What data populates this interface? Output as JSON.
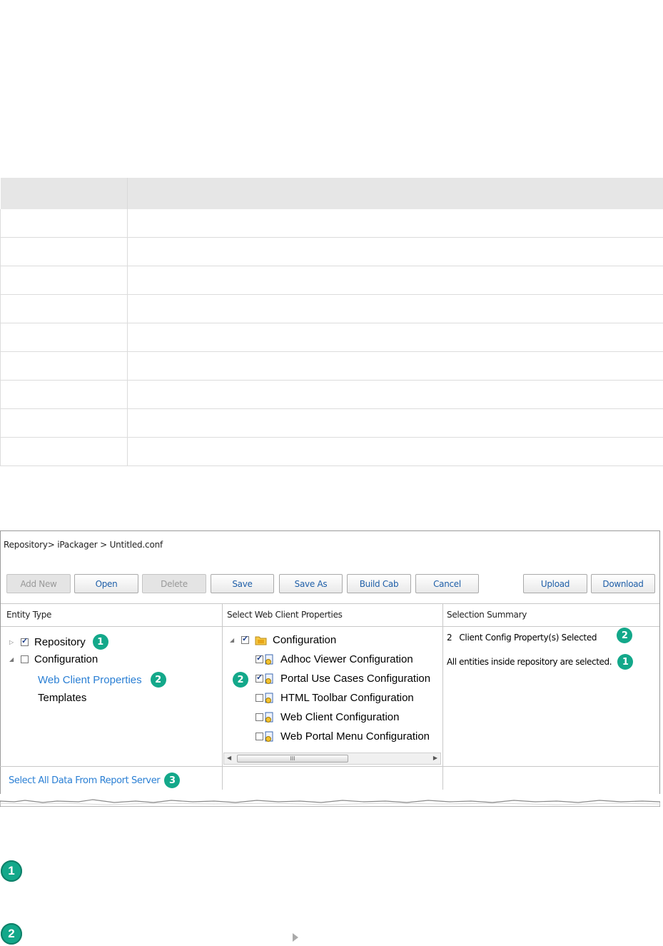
{
  "table": {
    "rows": 9
  },
  "screenshot": {
    "breadcrumb": "Repository> iPackager > Untitled.conf",
    "buttons": [
      {
        "label": "Add New",
        "disabled": true
      },
      {
        "label": "Open",
        "disabled": false
      },
      {
        "label": "Delete",
        "disabled": true
      },
      {
        "label": "Save",
        "disabled": false
      },
      {
        "label": "Save As",
        "disabled": false
      },
      {
        "label": "Build Cab",
        "disabled": false
      },
      {
        "label": "Cancel",
        "disabled": false
      },
      {
        "label": "Upload",
        "disabled": false
      },
      {
        "label": "Download",
        "disabled": false
      }
    ],
    "headers": {
      "entity_type": "Entity Type",
      "select_properties": "Select Web Client Properties",
      "selection_summary": "Selection Summary"
    },
    "entity_tree": {
      "repository": "Repository",
      "configuration": "Configuration",
      "web_client_properties": "Web Client Properties",
      "templates": "Templates"
    },
    "properties_tree": {
      "root": "Configuration",
      "items": [
        {
          "label": "Adhoc Viewer Configuration",
          "checked": true
        },
        {
          "label": "Portal Use Cases Configuration",
          "checked": true
        },
        {
          "label": "HTML Toolbar Configuration",
          "checked": false
        },
        {
          "label": "Web Client Configuration",
          "checked": false
        },
        {
          "label": "Web Portal Menu Configuration",
          "checked": false
        }
      ]
    },
    "summary": {
      "count": "2",
      "count_text": "Client Config Property(s) Selected",
      "all_text": "All entities inside repository are selected."
    },
    "select_all_link": "Select All Data From Report Server",
    "scroll_thumb_glyph": "III",
    "badges": {
      "one": "1",
      "two": "2",
      "three": "3"
    }
  },
  "colors": {
    "badge": "#13a88a",
    "link": "#2a7fd4",
    "button_text": "#1f5fa8"
  }
}
